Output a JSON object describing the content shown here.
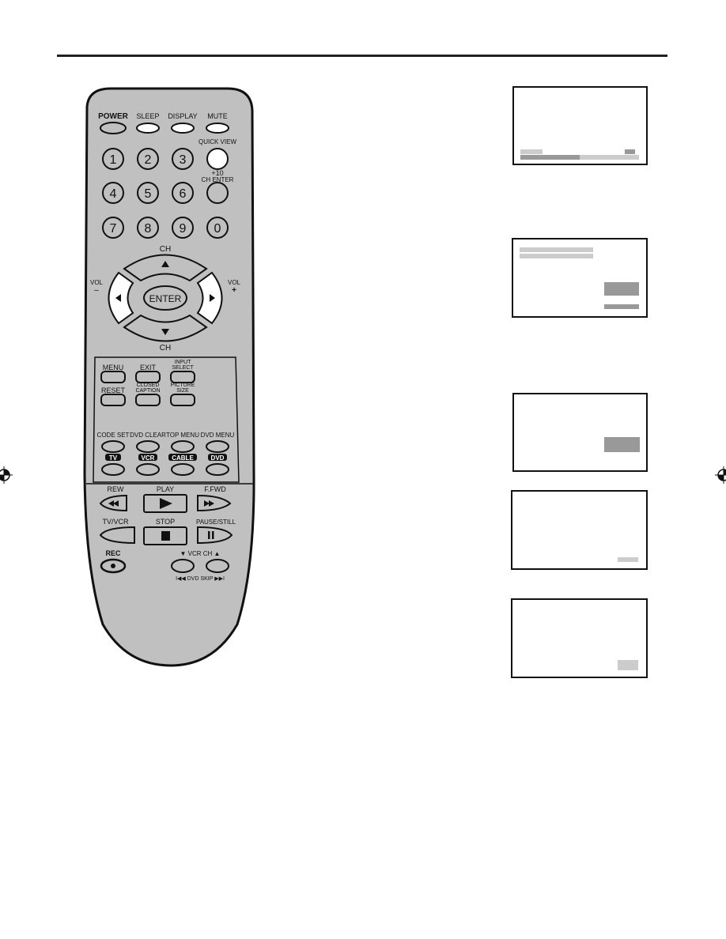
{
  "remote": {
    "body_color": "#c0c0c0",
    "top_row": [
      {
        "label": "POWER",
        "bold": true
      },
      {
        "label": "SLEEP"
      },
      {
        "label": "DISPLAY"
      },
      {
        "label": "MUTE"
      }
    ],
    "quick_view_label": "QUICK VIEW",
    "ch_enter_label_top": "+10",
    "ch_enter_label_bottom": "CH ENTER",
    "digits": [
      "1",
      "2",
      "3",
      "4",
      "5",
      "6",
      "7",
      "8",
      "9",
      "0"
    ],
    "dpad": {
      "ch_top": "CH",
      "ch_bottom": "CH",
      "vol_left": "VOL",
      "vol_left_sign": "–",
      "vol_right": "VOL",
      "vol_right_sign": "+",
      "enter": "ENTER"
    },
    "menu_panel": [
      {
        "label": "MENU"
      },
      {
        "label": "EXIT"
      },
      {
        "label": "INPUT SELECT",
        "line1": "INPUT",
        "line2": "SELECT"
      },
      {
        "label": "RESET"
      },
      {
        "label": "CLOSED CAPTION",
        "line1": "CLOSED",
        "line2": "CAPTION"
      },
      {
        "label": "PICTURE SIZE",
        "line1": "PICTURE",
        "line2": "SIZE"
      }
    ],
    "function_row": [
      "CODE SET",
      "DVD CLEAR",
      "TOP MENU",
      "DVD MENU"
    ],
    "mode_row": [
      "TV",
      "VCR",
      "CABLE",
      "DVD"
    ],
    "transport": {
      "rew": "REW",
      "play": "PLAY",
      "ffwd": "F.FWD",
      "tvvcr": "TV/VCR",
      "stop": "STOP",
      "pause": "PAUSE/STILL",
      "rec": "REC",
      "vcr_ch": "▼ VCR CH ▲",
      "dvd_skip": "I◀◀ DVD SKIP ▶▶I"
    }
  },
  "screens": [
    {
      "name": "volume-bar-screen",
      "volume_level_fraction": 0.5
    },
    {
      "name": "menu-screen"
    },
    {
      "name": "highlight-screen"
    },
    {
      "name": "small-label-screen"
    },
    {
      "name": "small-box-screen"
    }
  ],
  "colors": {
    "dark_gray": "#999999",
    "light_gray": "#cccccc",
    "outline": "#111111"
  }
}
